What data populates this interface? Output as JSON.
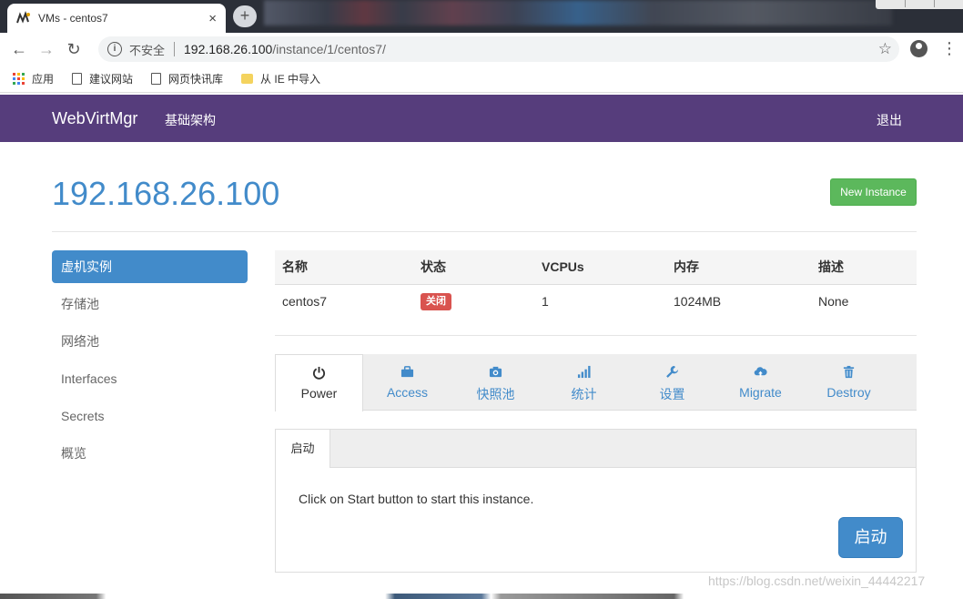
{
  "browser": {
    "tab_title": "VMs - centos7",
    "tab_close": "×",
    "new_tab": "+",
    "security_label": "不安全",
    "url_host": "192.168.26.100",
    "url_path": "/instance/1/centos7/",
    "bookmarks": [
      {
        "label": "应用",
        "icon": "apps-icon"
      },
      {
        "label": "建议网站",
        "icon": "page-icon"
      },
      {
        "label": "网页快讯库",
        "icon": "page-icon"
      },
      {
        "label": "从 IE 中导入",
        "icon": "folder-icon"
      }
    ]
  },
  "navbar": {
    "brand": "WebVirtMgr",
    "link": "基础架构",
    "logout": "退出",
    "bg_color": "#563d7c"
  },
  "page": {
    "host": "192.168.26.100",
    "new_instance": "New Instance"
  },
  "sidebar": {
    "items": [
      {
        "label": "虚机实例",
        "active": true
      },
      {
        "label": "存储池"
      },
      {
        "label": "网络池"
      },
      {
        "label": "Interfaces"
      },
      {
        "label": "Secrets"
      },
      {
        "label": "概览"
      }
    ]
  },
  "instance_table": {
    "headers": [
      "名称",
      "状态",
      "VCPUs",
      "内存",
      "描述"
    ],
    "row": {
      "name": "centos7",
      "status": "关闭",
      "vcpus": "1",
      "memory": "1024MB",
      "description": "None"
    },
    "status_color": "#d9534f"
  },
  "tabs": [
    {
      "label": "Power",
      "icon": "power-icon",
      "active": true
    },
    {
      "label": "Access",
      "icon": "briefcase-icon"
    },
    {
      "label": "快照池",
      "icon": "camera-icon"
    },
    {
      "label": "统计",
      "icon": "signal-icon"
    },
    {
      "label": "设置",
      "icon": "wrench-icon"
    },
    {
      "label": "Migrate",
      "icon": "cloud-upload-icon"
    },
    {
      "label": "Destroy",
      "icon": "trash-icon"
    }
  ],
  "power_panel": {
    "subtab": "启动",
    "message": "Click on Start button to start this instance.",
    "start_button": "启动"
  },
  "watermark": "https://blog.csdn.net/weixin_44442217",
  "colors": {
    "primary": "#428bca",
    "success": "#5cb85c",
    "danger": "#d9534f"
  }
}
